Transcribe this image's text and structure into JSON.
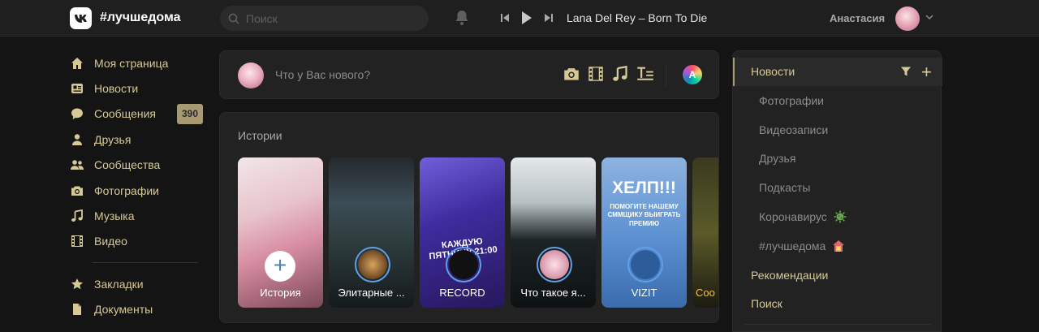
{
  "header": {
    "brand": "#лучшедома",
    "search_placeholder": "Поиск",
    "track": "Lana Del Rey – Born To Die",
    "user_name": "Анастасия"
  },
  "sidebar": {
    "items": [
      {
        "label": "Моя страница",
        "icon": "home-icon"
      },
      {
        "label": "Новости",
        "icon": "news-icon"
      },
      {
        "label": "Сообщения",
        "icon": "messages-icon",
        "badge": "390"
      },
      {
        "label": "Друзья",
        "icon": "friends-icon"
      },
      {
        "label": "Сообщества",
        "icon": "communities-icon"
      },
      {
        "label": "Фотографии",
        "icon": "camera-icon"
      },
      {
        "label": "Музыка",
        "icon": "music-icon"
      },
      {
        "label": "Видео",
        "icon": "video-icon"
      }
    ],
    "items2": [
      {
        "label": "Закладки",
        "icon": "star-icon"
      },
      {
        "label": "Документы",
        "icon": "document-icon"
      }
    ]
  },
  "composer": {
    "placeholder": "Что у Вас нового?"
  },
  "stories": {
    "title": "Истории",
    "items": [
      {
        "name": "История"
      },
      {
        "name": "Элитарные ..."
      },
      {
        "name": "RECORD"
      },
      {
        "name": "Что такое я..."
      },
      {
        "name": "VIZIT"
      },
      {
        "name": "Соо"
      }
    ],
    "vizit_card_text": "ХЕЛП!!!",
    "vizit_card_sub": "ПОМОГИТЕ НАШЕМУ СММЩИКУ ВЫИГРАТЬ ПРЕМИЮ",
    "record_card_text": "КАЖДУЮ ПЯТНИЦУ 21:00"
  },
  "right_menu": {
    "active": "Новости",
    "subs": [
      "Фотографии",
      "Видеозаписи",
      "Друзья",
      "Подкасты",
      "Коронавирус",
      "#лучшедома"
    ],
    "mains": [
      "Рекомендации",
      "Поиск"
    ]
  },
  "colors": {
    "accent": "#d7c995",
    "badge": "#a79a73",
    "background": "#141414"
  }
}
